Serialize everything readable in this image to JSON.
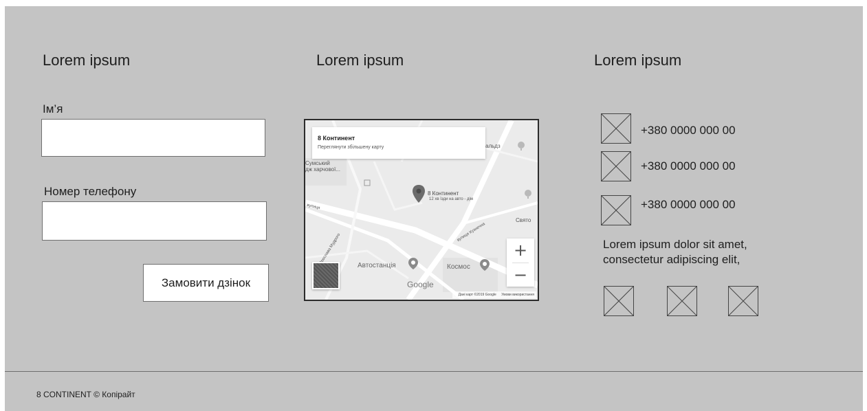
{
  "columns": {
    "form_title": "Lorem ipsum",
    "map_title": "Lorem ipsum",
    "contacts_title": "Lorem ipsum"
  },
  "form": {
    "name_label": "Ім’я",
    "name_value": "",
    "phone_label": "Номер телефону",
    "phone_value": "",
    "submit_label": "Замовити дзінок"
  },
  "map": {
    "place_title": "8 Континент",
    "view_larger_link": "Переглянути збільшену карту",
    "pin_label": "8 Континент",
    "pin_sublabel": "12 хв їзди на авто - дім",
    "labels": {
      "sumskyi": "Сумський",
      "kharchovoi": "дж харчової...",
      "street_left": "вулиця",
      "svyato": "Свято",
      "kuznechna": "вулиця Кузнечна",
      "bus_station": "Автостанція",
      "kosmos": "Космос",
      "yaroslava": "вул. Ярослава Мудрого",
      "alda": "альдз"
    },
    "zoom_in": "+",
    "zoom_out": "−",
    "google_logo": "Google",
    "footer_data": "Дані карт ©2019 Google",
    "footer_terms": "Умови використання"
  },
  "contacts": {
    "phones": [
      "+380 0000 000 00",
      "+380 0000 000 00",
      "+380 0000 000 00"
    ],
    "description": "Lorem ipsum dolor sit amet, consectetur adipiscing elit,"
  },
  "footer": {
    "copyright": "8 CONTINENT © Копірайт"
  },
  "colors": {
    "background": "#c4c4c4",
    "border": "#6f6f6f",
    "map_bg": "#e8e8e8"
  }
}
